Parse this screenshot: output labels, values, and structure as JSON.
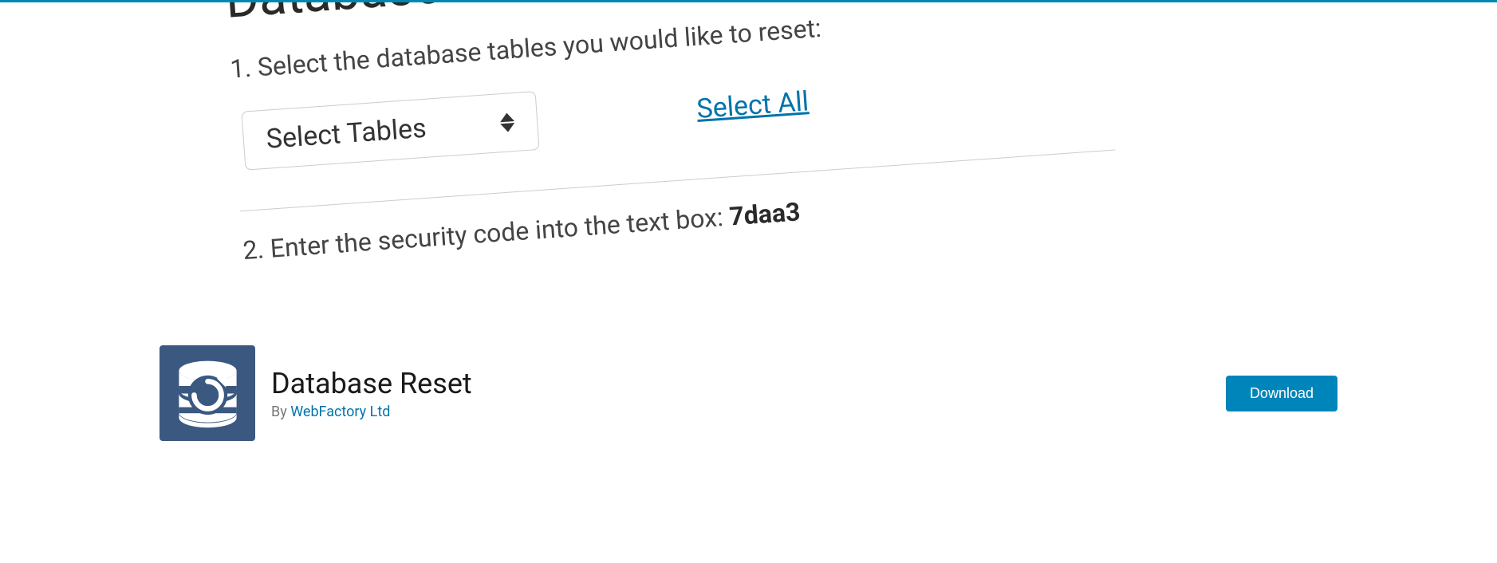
{
  "banner": {
    "title": "Database R",
    "step1": "1. Select the database tables you would like to reset:",
    "selectLabel": "Select Tables",
    "selectAll": "Select All",
    "step2_prefix": "2. Enter the security code into the text box:  ",
    "securityCode": "7daa3"
  },
  "plugin": {
    "title": "Database Reset",
    "byText": "By ",
    "authorName": "WebFactory Ltd",
    "downloadLabel": "Download"
  }
}
